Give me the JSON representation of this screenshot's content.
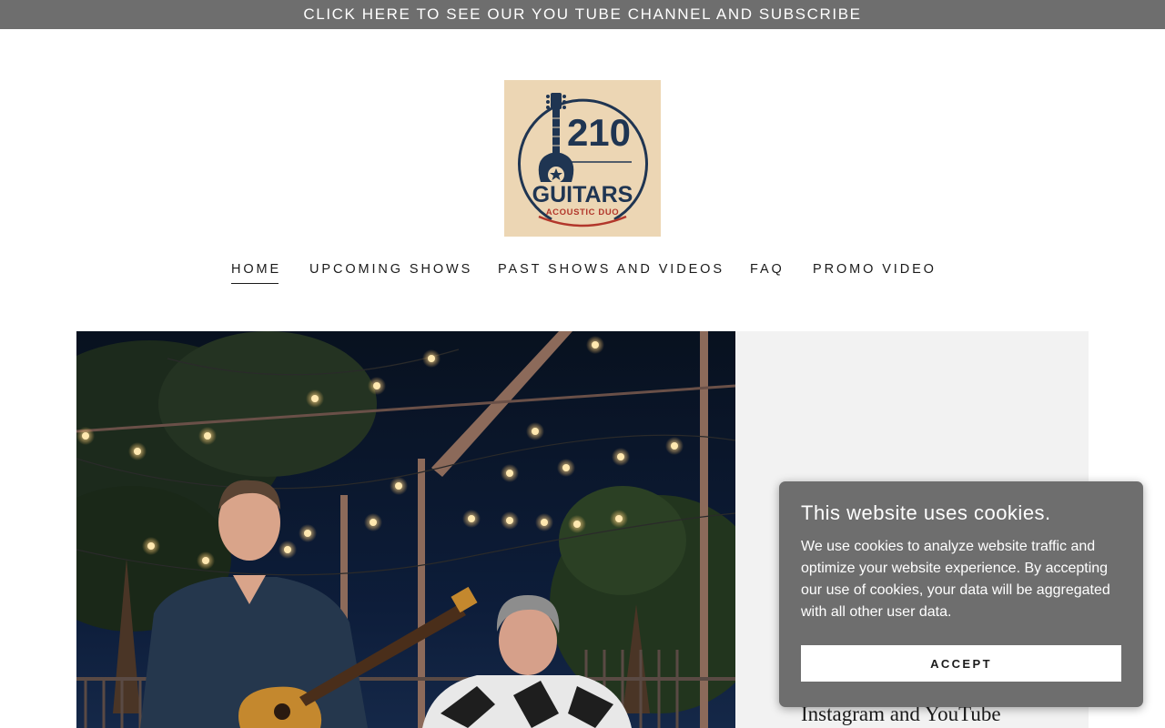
{
  "banner": {
    "text": "CLICK HERE TO SEE OUR YOU TUBE CHANNEL AND SUBSCRIBE"
  },
  "logo": {
    "number": "210",
    "name": "GUITARS",
    "tagline": "ACOUSTIC DUO"
  },
  "nav": {
    "items": [
      {
        "label": "HOME",
        "active": true
      },
      {
        "label": "UPCOMING SHOWS",
        "active": false
      },
      {
        "label": "PAST SHOWS AND VIDEOS",
        "active": false
      },
      {
        "label": "FAQ",
        "active": false
      },
      {
        "label": "PROMO VIDEO",
        "active": false
      }
    ]
  },
  "hero": {
    "icon": "hero-photo"
  },
  "side": {
    "heading": "Instagram and YouTube"
  },
  "cookie": {
    "title": "This website uses cookies.",
    "body": "We use cookies to analyze website traffic and optimize your website experience. By accepting our use of cookies, your data will be aggregated with all other user data.",
    "accept_label": "ACCEPT"
  },
  "colors": {
    "banner_bg": "#6e6e6e",
    "logo_bg": "#ecd6b4",
    "logo_navy": "#1f3552",
    "logo_red": "#b2372b",
    "side_bg": "#f2f2f2",
    "cookie_bg": "#6e6e6e"
  }
}
